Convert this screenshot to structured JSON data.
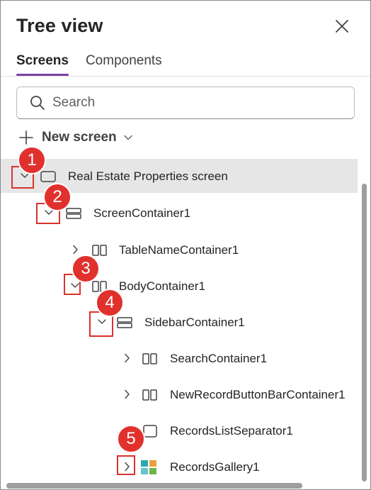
{
  "header": {
    "title": "Tree view"
  },
  "tabs": [
    {
      "label": "Screens",
      "active": true
    },
    {
      "label": "Components",
      "active": false
    }
  ],
  "search": {
    "placeholder": "Search",
    "value": ""
  },
  "new_screen": {
    "label": "New screen"
  },
  "tree": [
    {
      "label": "Real Estate Properties screen",
      "toggle": "expanded",
      "icon": "screen-icon",
      "selected": true,
      "callout": "1"
    },
    {
      "label": "ScreenContainer1",
      "toggle": "expanded",
      "icon": "vertical-container-icon",
      "selected": false,
      "callout": "2"
    },
    {
      "label": "TableNameContainer1",
      "toggle": "collapsed",
      "icon": "horizontal-container-icon",
      "selected": false,
      "callout": ""
    },
    {
      "label": "BodyContainer1",
      "toggle": "expanded",
      "icon": "horizontal-container-icon",
      "selected": false,
      "callout": "3"
    },
    {
      "label": "SidebarContainer1",
      "toggle": "expanded",
      "icon": "vertical-container-icon",
      "selected": false,
      "callout": "4"
    },
    {
      "label": "SearchContainer1",
      "toggle": "collapsed",
      "icon": "horizontal-container-icon",
      "selected": false,
      "callout": ""
    },
    {
      "label": "NewRecordButtonBarContainer1",
      "toggle": "collapsed",
      "icon": "horizontal-container-icon",
      "selected": false,
      "callout": ""
    },
    {
      "label": "RecordsListSeparator1",
      "toggle": "none",
      "icon": "rectangle-icon",
      "selected": false,
      "callout": ""
    },
    {
      "label": "RecordsGallery1",
      "toggle": "collapsed",
      "icon": "gallery-icon",
      "selected": false,
      "callout": "5"
    }
  ],
  "colors": {
    "tab_accent": "#7b3fa4",
    "callout_red": "#e0312d",
    "selected_row": "#e6e6e6",
    "gallery_teal": "#2aa8b8",
    "gallery_orange": "#e8a03a",
    "gallery_green": "#6bb34a"
  }
}
